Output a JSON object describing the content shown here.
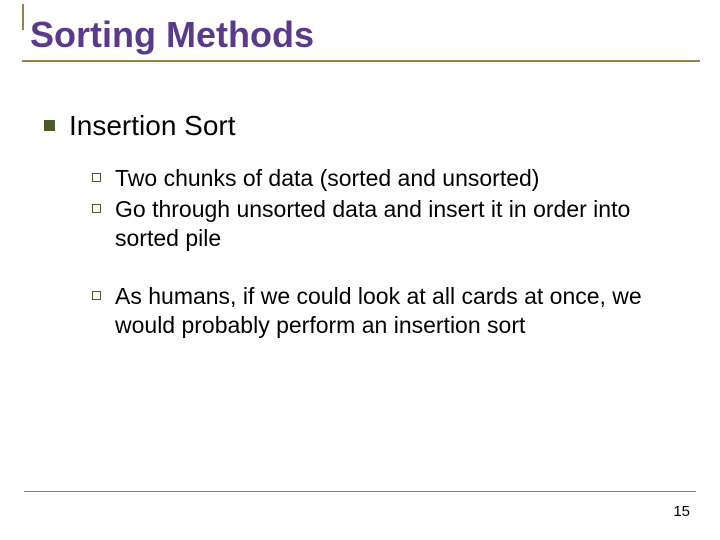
{
  "title": "Sorting Methods",
  "level1": {
    "text": "Insertion Sort"
  },
  "sub": [
    {
      "text": "Two chunks of data (sorted and unsorted)"
    },
    {
      "text": "Go through unsorted data and insert it in order into sorted pile"
    },
    {
      "text": "As humans, if we could look at all cards at once, we would probably perform an insertion sort"
    }
  ],
  "pageNumber": "15"
}
